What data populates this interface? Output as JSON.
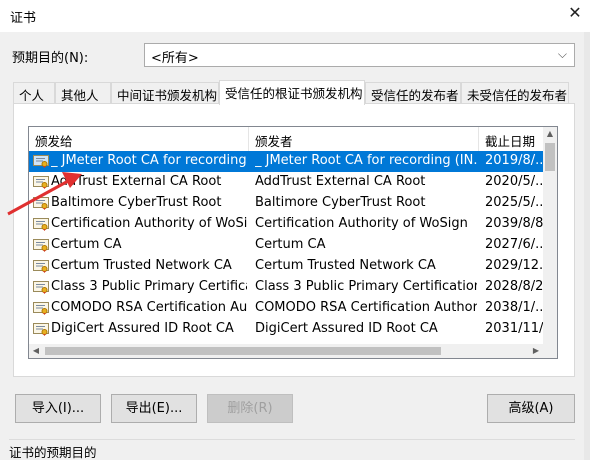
{
  "window": {
    "title": "证书",
    "close_glyph": "✕"
  },
  "purpose": {
    "label": "预期目的(N):",
    "value": "<所有>"
  },
  "tabs": [
    {
      "label": "个人"
    },
    {
      "label": "其他人"
    },
    {
      "label": "中间证书颁发机构"
    },
    {
      "label": "受信任的根证书颁发机构",
      "active": true
    },
    {
      "label": "受信任的发布者"
    },
    {
      "label": "未受信任的发布者"
    }
  ],
  "columns": {
    "issued_to": "颁发给",
    "issued_by": "颁发者",
    "expiration": "截止日期"
  },
  "rows": [
    {
      "to": "_ JMeter Root CA for recording ...",
      "by": "_ JMeter Root CA for recording (IN...",
      "exp": "2019/8/...",
      "selected": true
    },
    {
      "to": "AddTrust External CA Root",
      "by": "AddTrust External CA Root",
      "exp": "2020/5/..."
    },
    {
      "to": "Baltimore CyberTrust Root",
      "by": "Baltimore CyberTrust Root",
      "exp": "2025/5/..."
    },
    {
      "to": "Certification Authority of WoSign",
      "by": "Certification Authority of WoSign",
      "exp": "2039/8/8"
    },
    {
      "to": "Certum CA",
      "by": "Certum CA",
      "exp": "2027/6/..."
    },
    {
      "to": "Certum Trusted Network CA",
      "by": "Certum Trusted Network CA",
      "exp": "2029/12..."
    },
    {
      "to": "Class 3 Public Primary Certificati...",
      "by": "Class 3 Public Primary Certification ...",
      "exp": "2028/8/2"
    },
    {
      "to": "COMODO RSA Certification Aut...",
      "by": "COMODO RSA Certification Authority",
      "exp": "2038/1/..."
    },
    {
      "to": "DigiCert Assured ID Root CA",
      "by": "DigiCert Assured ID Root CA",
      "exp": "2031/11/..."
    }
  ],
  "buttons": {
    "import": "导入(I)...",
    "export": "导出(E)...",
    "remove": "删除(R)",
    "advanced": "高级(A)"
  },
  "group": {
    "title": "证书的预期目的"
  },
  "colors": {
    "selection": "#0078d7",
    "annotation_arrow": "#e03030"
  }
}
